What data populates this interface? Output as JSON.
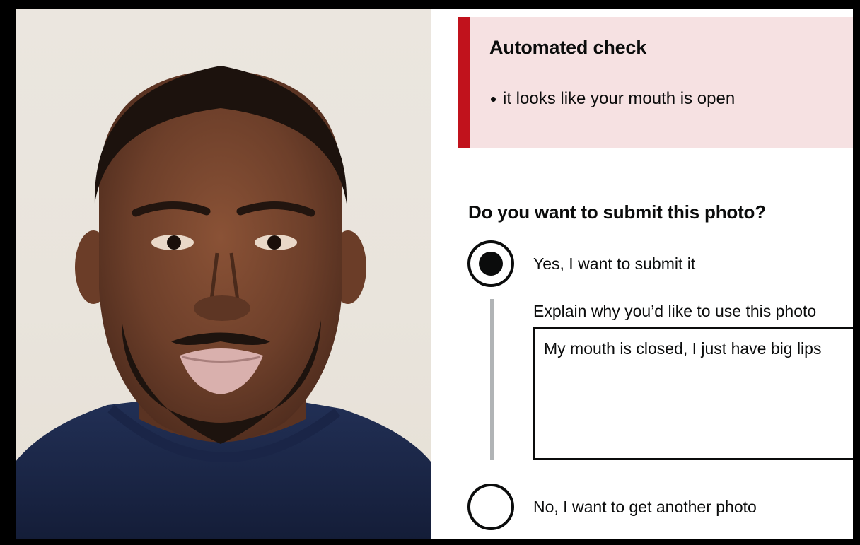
{
  "error_summary": {
    "title": "Automated check",
    "items": [
      "it looks like your mouth is open"
    ],
    "accent_color": "#c1121c",
    "background_color": "#f6e1e2"
  },
  "form": {
    "question": "Do you want to submit this photo?",
    "options": [
      {
        "label": "Yes, I want to submit it",
        "selected": true
      },
      {
        "label": "No, I want to get another photo",
        "selected": false
      }
    ],
    "explain_label": "Explain why you’d like to use this photo",
    "explain_value": "My mouth is closed, I just have big lips"
  }
}
